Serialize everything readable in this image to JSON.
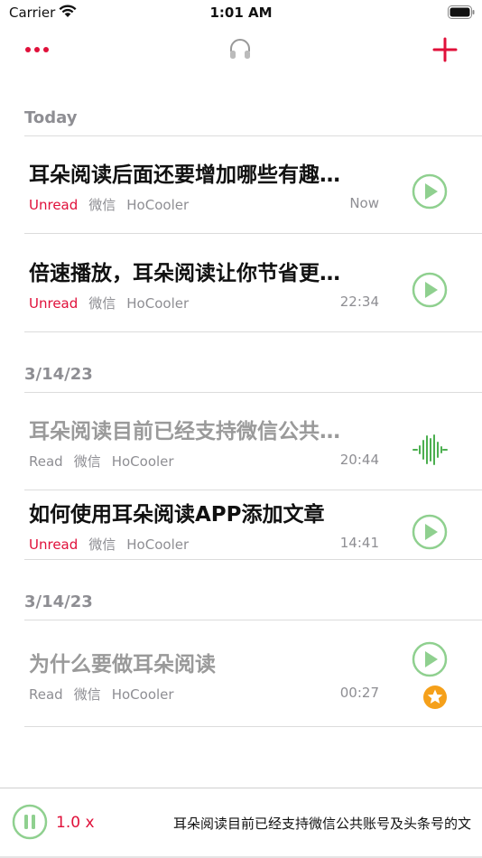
{
  "status_bar": {
    "carrier": "Carrier",
    "time": "1:01 AM"
  },
  "colors": {
    "accent": "#e0103a",
    "play_green": "#8fd08f",
    "wave_green": "#4caf50",
    "star_orange": "#f5a01a",
    "gray": "#8e8e93"
  },
  "nav": {
    "more_icon": "more-dots-icon",
    "center_icon": "headphones-icon",
    "add_icon": "plus-icon"
  },
  "sections": [
    {
      "header": "Today",
      "items": [
        {
          "title": "耳朵阅读后面还要增加哪些有趣…",
          "status": "Unread",
          "source": "微信",
          "author": "HoCooler",
          "time": "Now",
          "icon": "play-icon"
        },
        {
          "title": "倍速播放，耳朵阅读让你节省更…",
          "status": "Unread",
          "source": "微信",
          "author": "HoCooler",
          "time": "22:34",
          "icon": "play-icon"
        }
      ]
    },
    {
      "header": "3/14/23",
      "items": [
        {
          "title": "耳朵阅读目前已经支持微信公共…",
          "status": "Read",
          "source": "微信",
          "author": "HoCooler",
          "time": "20:44",
          "icon": "waveform-icon"
        },
        {
          "title": "如何使用耳朵阅读APP添加文章",
          "status": "Unread",
          "source": "微信",
          "author": "HoCooler",
          "time": "14:41",
          "icon": "play-icon"
        }
      ]
    },
    {
      "header": "3/14/23",
      "items": [
        {
          "title": "为什么要做耳朵阅读",
          "status": "Read",
          "source": "微信",
          "author": "HoCooler",
          "time": "00:27",
          "icon": "play-icon",
          "starred": true
        }
      ]
    }
  ],
  "player": {
    "speed": "1.0 x",
    "now_playing": "耳朵阅读目前已经支持微信公共账号及头条号的文"
  }
}
